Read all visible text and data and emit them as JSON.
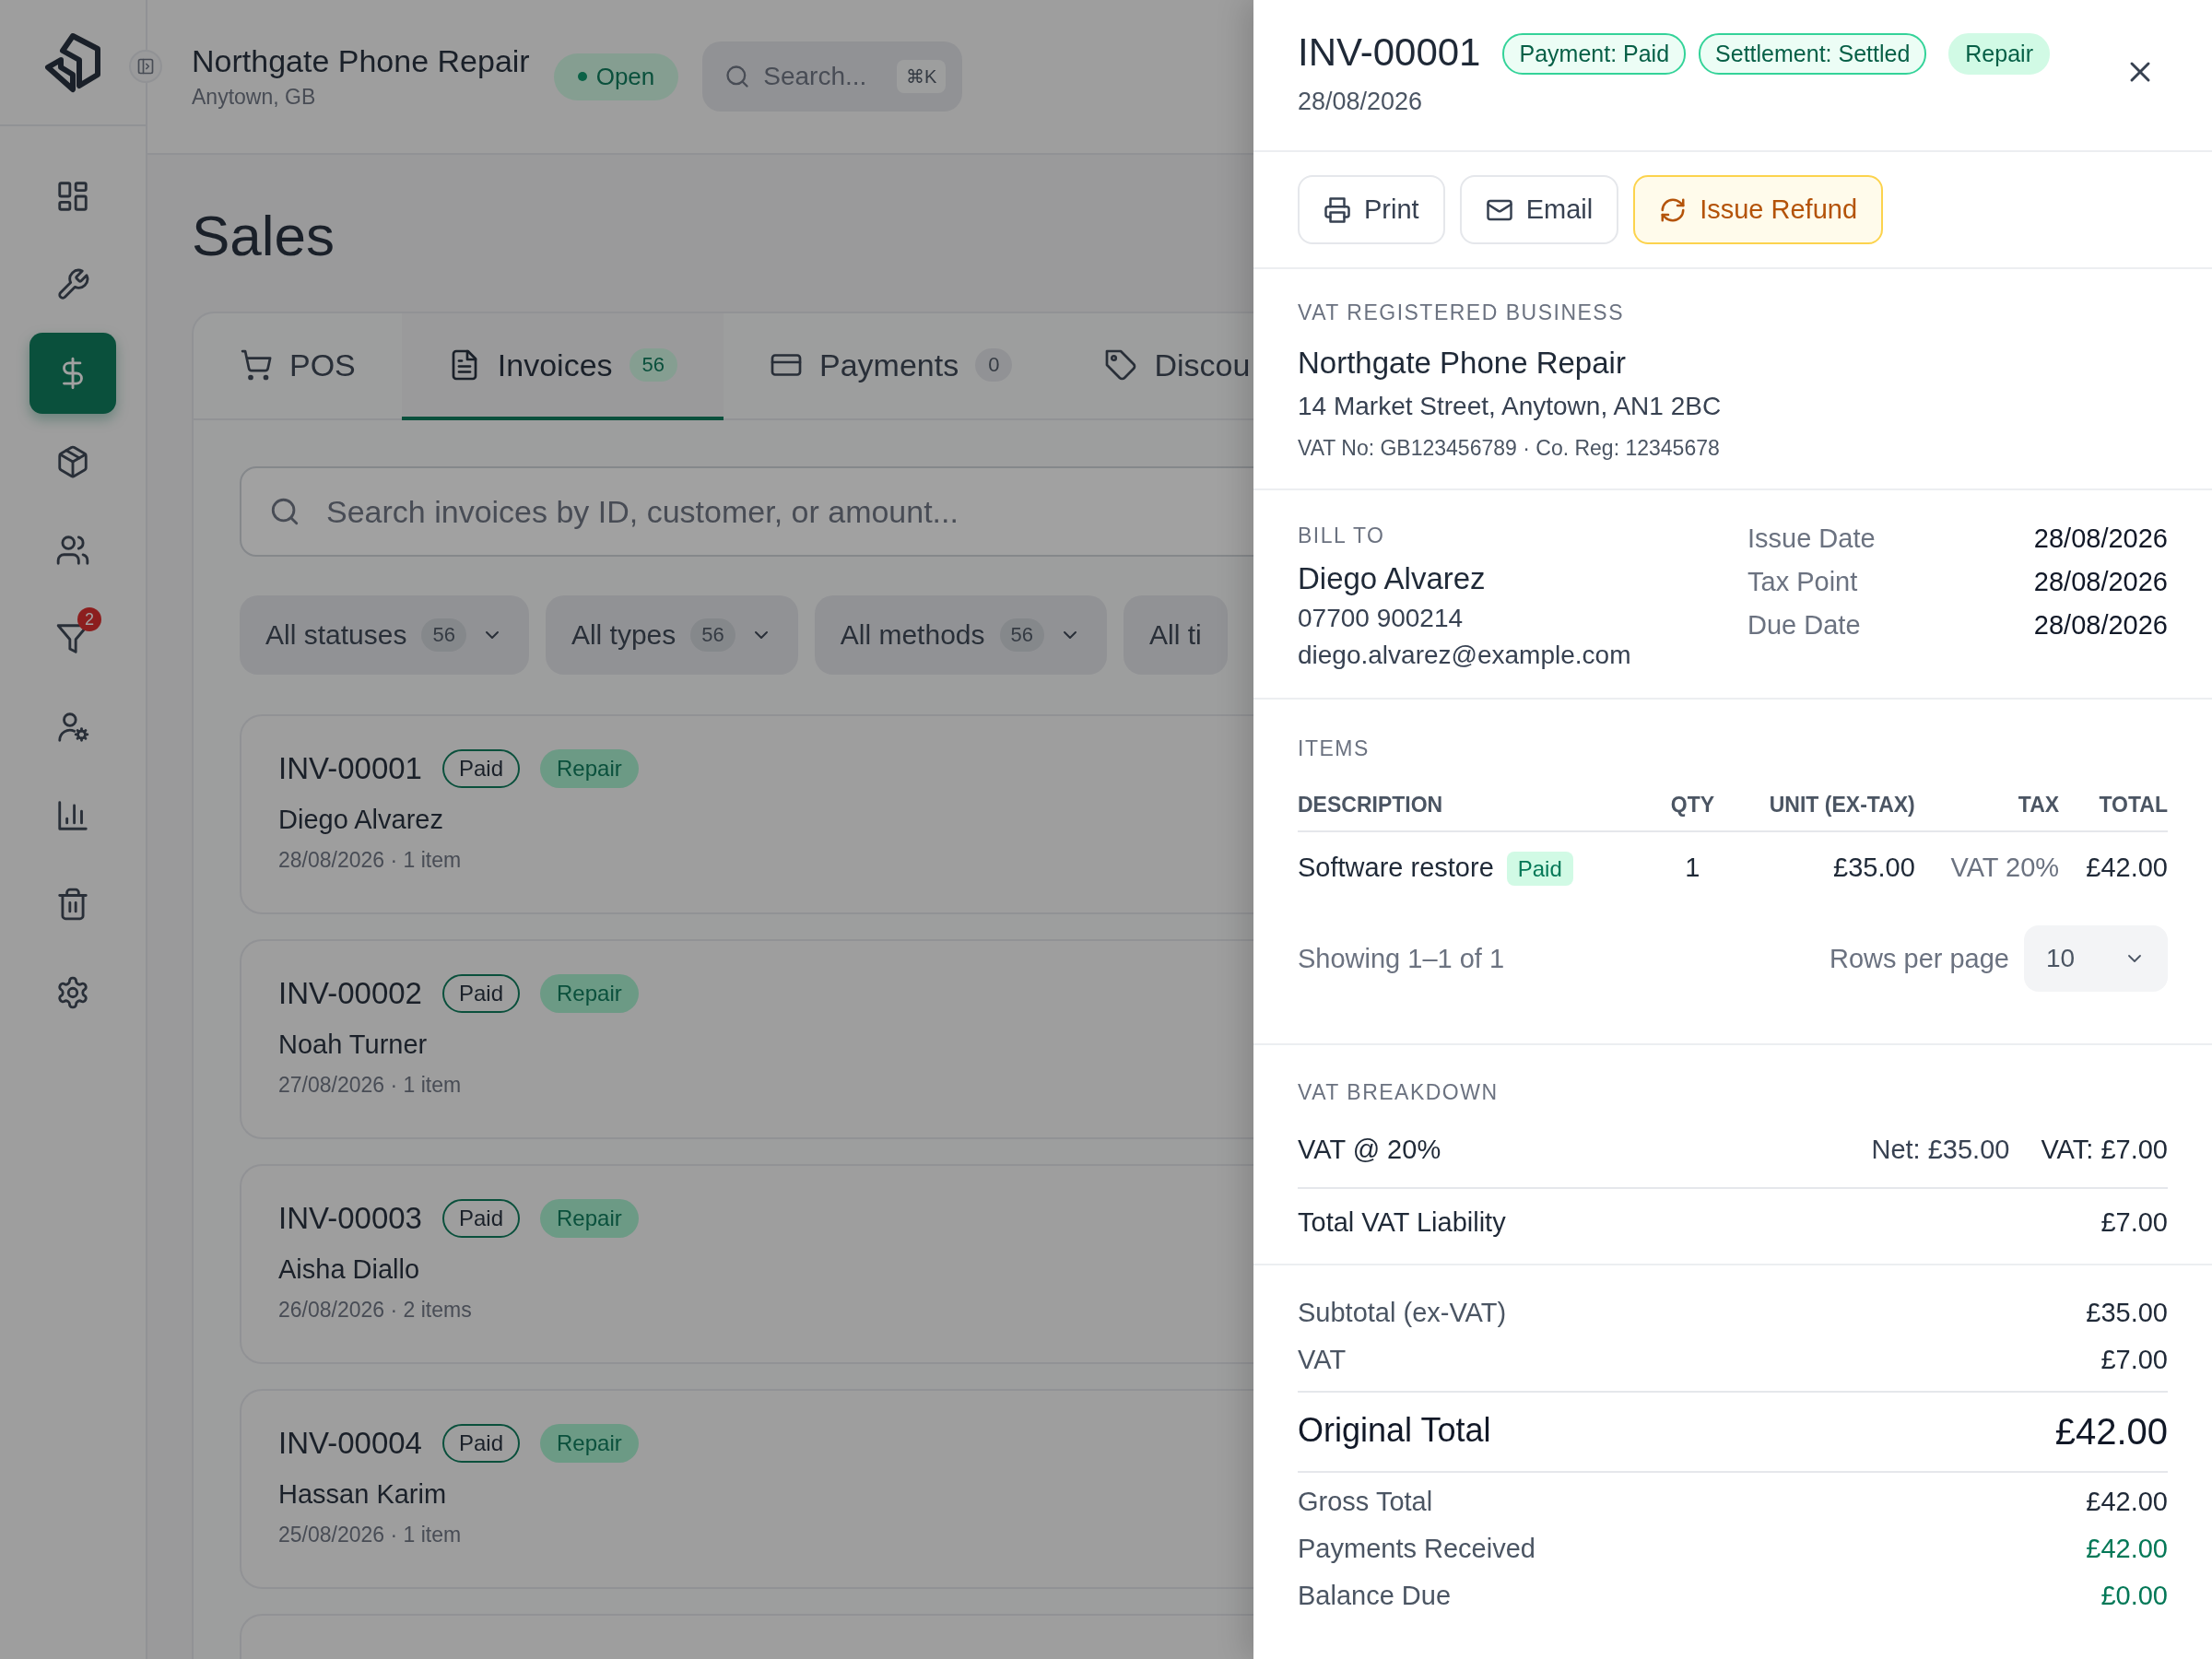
{
  "sidebar": {
    "items": [
      {
        "kind": "dashboard",
        "selected": false
      },
      {
        "kind": "wrench",
        "selected": false
      },
      {
        "kind": "dollar",
        "selected": true
      },
      {
        "kind": "package",
        "selected": false
      },
      {
        "kind": "users",
        "selected": false
      },
      {
        "kind": "filter",
        "selected": false,
        "badge": "2"
      },
      {
        "kind": "user-gear",
        "selected": false
      },
      {
        "kind": "chart",
        "selected": false
      },
      {
        "kind": "trash",
        "selected": false
      },
      {
        "kind": "settings",
        "selected": false
      }
    ]
  },
  "header": {
    "business_name": "Northgate Phone Repair",
    "location": "Anytown, GB",
    "status": "Open",
    "search": {
      "placeholder": "Search...",
      "shortcut": "⌘K"
    }
  },
  "page_title": "Sales",
  "tabs": [
    {
      "label": "POS",
      "kind": "cart",
      "selected": false
    },
    {
      "label": "Invoices",
      "kind": "document",
      "count": "56",
      "selected": true
    },
    {
      "label": "Payments",
      "kind": "card",
      "count": "0",
      "selected": false
    },
    {
      "label": "Discou",
      "kind": "tag",
      "selected": false
    }
  ],
  "invoice_search": {
    "placeholder": "Search invoices by ID, customer, or amount..."
  },
  "filters": [
    {
      "label": "All statuses",
      "count": "56"
    },
    {
      "label": "All types",
      "count": "56"
    },
    {
      "label": "All methods",
      "count": "56"
    },
    {
      "label": "All ti"
    }
  ],
  "invoices": [
    {
      "id": "INV-00001",
      "payment": "Paid",
      "type": "Repair",
      "customer": "Diego Alvarez",
      "meta": "28/08/2026 · 1 item"
    },
    {
      "id": "INV-00002",
      "payment": "Paid",
      "type": "Repair",
      "customer": "Noah Turner",
      "meta": "27/08/2026 · 1 item"
    },
    {
      "id": "INV-00003",
      "payment": "Paid",
      "type": "Repair",
      "customer": "Aisha Diallo",
      "meta": "26/08/2026 · 2 items"
    },
    {
      "id": "INV-00004",
      "payment": "Paid",
      "type": "Repair",
      "customer": "Hassan Karim",
      "meta": "25/08/2026 · 1 item"
    }
  ],
  "detail": {
    "invoice_id": "INV-00001",
    "date": "28/08/2026",
    "badges": [
      {
        "label": "Payment: Paid",
        "kind": "outline"
      },
      {
        "label": "Settlement: Settled",
        "kind": "outline"
      },
      {
        "label": "Repair",
        "kind": "filled"
      }
    ],
    "actions": [
      {
        "label": "Print",
        "kind": "print"
      },
      {
        "label": "Email",
        "kind": "email"
      },
      {
        "label": "Issue Refund",
        "kind": "refund"
      }
    ],
    "business": {
      "heading": "VAT REGISTERED BUSINESS",
      "name": "Northgate Phone Repair",
      "address": "14 Market Street, Anytown, AN1 2BC",
      "registration": "VAT No: GB123456789 · Co. Reg: 12345678"
    },
    "bill_to": {
      "heading": "BILL TO",
      "name": "Diego Alvarez",
      "phone": "07700 900214",
      "email": "diego.alvarez@example.com"
    },
    "dates": [
      {
        "label": "Issue Date",
        "value": "28/08/2026"
      },
      {
        "label": "Tax Point",
        "value": "28/08/2026"
      },
      {
        "label": "Due Date",
        "value": "28/08/2026"
      }
    ],
    "items": {
      "heading": "ITEMS",
      "columns": [
        "DESCRIPTION",
        "QTY",
        "UNIT (EX-TAX)",
        "TAX",
        "TOTAL"
      ],
      "rows": [
        {
          "description": "Software restore",
          "status": "Paid",
          "qty": "1",
          "unit": "£35.00",
          "tax": "VAT 20%",
          "total": "£42.00"
        }
      ],
      "showing": "Showing 1–1 of 1",
      "rows_per_page": {
        "label": "Rows per page",
        "value": "10"
      }
    },
    "vat_breakdown": {
      "heading": "VAT BREAKDOWN",
      "rows": [
        {
          "label": "VAT @ 20%",
          "net": "Net: £35.00",
          "vat": "VAT: £7.00"
        }
      ],
      "total": {
        "label": "Total VAT Liability",
        "value": "£7.00"
      }
    },
    "totals": [
      {
        "label": "Subtotal (ex-VAT)",
        "value": "£35.00",
        "kind": "plain"
      },
      {
        "label": "VAT",
        "value": "£7.00",
        "kind": "plain"
      },
      {
        "label": "Original Total",
        "value": "£42.00",
        "kind": "grand"
      },
      {
        "label": "Gross Total",
        "value": "£42.00",
        "kind": "plain"
      },
      {
        "label": "Payments Received",
        "value": "£42.00",
        "kind": "positive"
      },
      {
        "label": "Balance Due",
        "value": "£0.00",
        "kind": "positive"
      }
    ]
  }
}
